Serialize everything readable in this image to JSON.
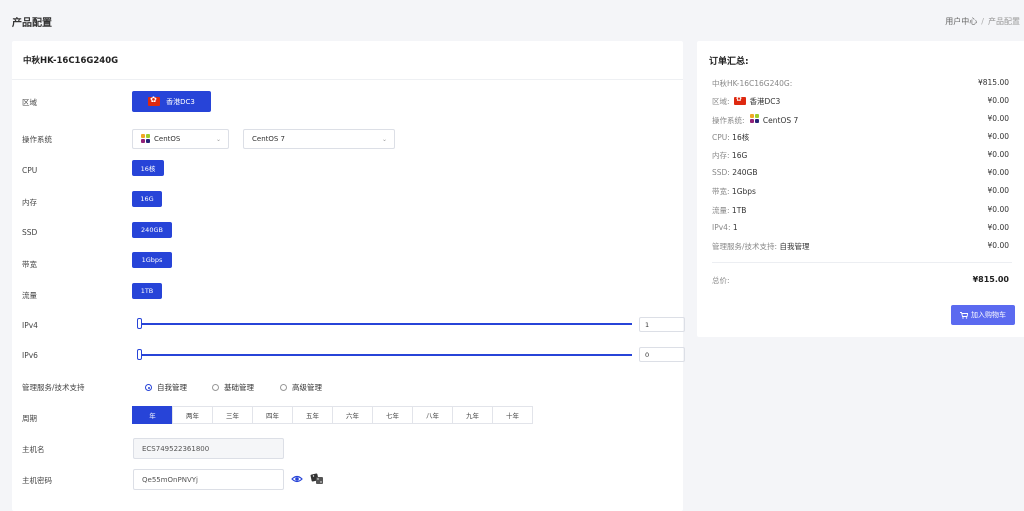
{
  "header": {
    "title": "产品配置",
    "breadcrumb": [
      "用户中心",
      "产品配置"
    ]
  },
  "product": {
    "name": "中秋HK-16C16G240G"
  },
  "config": {
    "region": {
      "label": "区域",
      "value": "香港DC3"
    },
    "os": {
      "label": "操作系统",
      "family": "CentOS",
      "version": "CentOS 7"
    },
    "cpu": {
      "label": "CPU",
      "value": "16核"
    },
    "memory": {
      "label": "内存",
      "value": "16G"
    },
    "ssd": {
      "label": "SSD",
      "value": "240GB"
    },
    "bandwidth": {
      "label": "带宽",
      "value": "1Gbps"
    },
    "traffic": {
      "label": "流量",
      "value": "1TB"
    },
    "ipv4": {
      "label": "IPv4",
      "value": "1"
    },
    "ipv6": {
      "label": "IPv6",
      "value": "0"
    },
    "management": {
      "label": "管理服务/技术支持",
      "options": [
        "自我管理",
        "基础管理",
        "高级管理"
      ],
      "selected": "自我管理"
    },
    "period": {
      "label": "周期",
      "options": [
        "年",
        "两年",
        "三年",
        "四年",
        "五年",
        "六年",
        "七年",
        "八年",
        "九年",
        "十年"
      ],
      "selected": "年"
    },
    "hostname": {
      "label": "主机名",
      "value": "ECS749522361800"
    },
    "password": {
      "label": "主机密码",
      "value": "Qe55mOnPNVYj"
    }
  },
  "summary": {
    "title": "订单汇总:",
    "lines": [
      {
        "label": "中秋HK-16C16G240G:",
        "value": "",
        "price": "¥815.00"
      },
      {
        "label": "区域:",
        "value": "香港DC3",
        "price": "¥0.00"
      },
      {
        "label": "操作系统:",
        "value": "CentOS 7",
        "price": "¥0.00"
      },
      {
        "label": "CPU:",
        "value": "16核",
        "price": "¥0.00"
      },
      {
        "label": "内存:",
        "value": "16G",
        "price": "¥0.00"
      },
      {
        "label": "SSD:",
        "value": "240GB",
        "price": "¥0.00"
      },
      {
        "label": "带宽:",
        "value": "1Gbps",
        "price": "¥0.00"
      },
      {
        "label": "流量:",
        "value": "1TB",
        "price": "¥0.00"
      },
      {
        "label": "IPv4:",
        "value": "1",
        "price": "¥0.00"
      },
      {
        "label": "管理服务/技术支持:",
        "value": "自我管理",
        "price": "¥0.00"
      }
    ],
    "total_label": "总价:",
    "total_price": "¥815.00",
    "add_to_cart": "加入购物车"
  },
  "colors": {
    "primary": "#2744d8",
    "cart_button": "#5b6af0",
    "background": "#f4f5f8"
  }
}
